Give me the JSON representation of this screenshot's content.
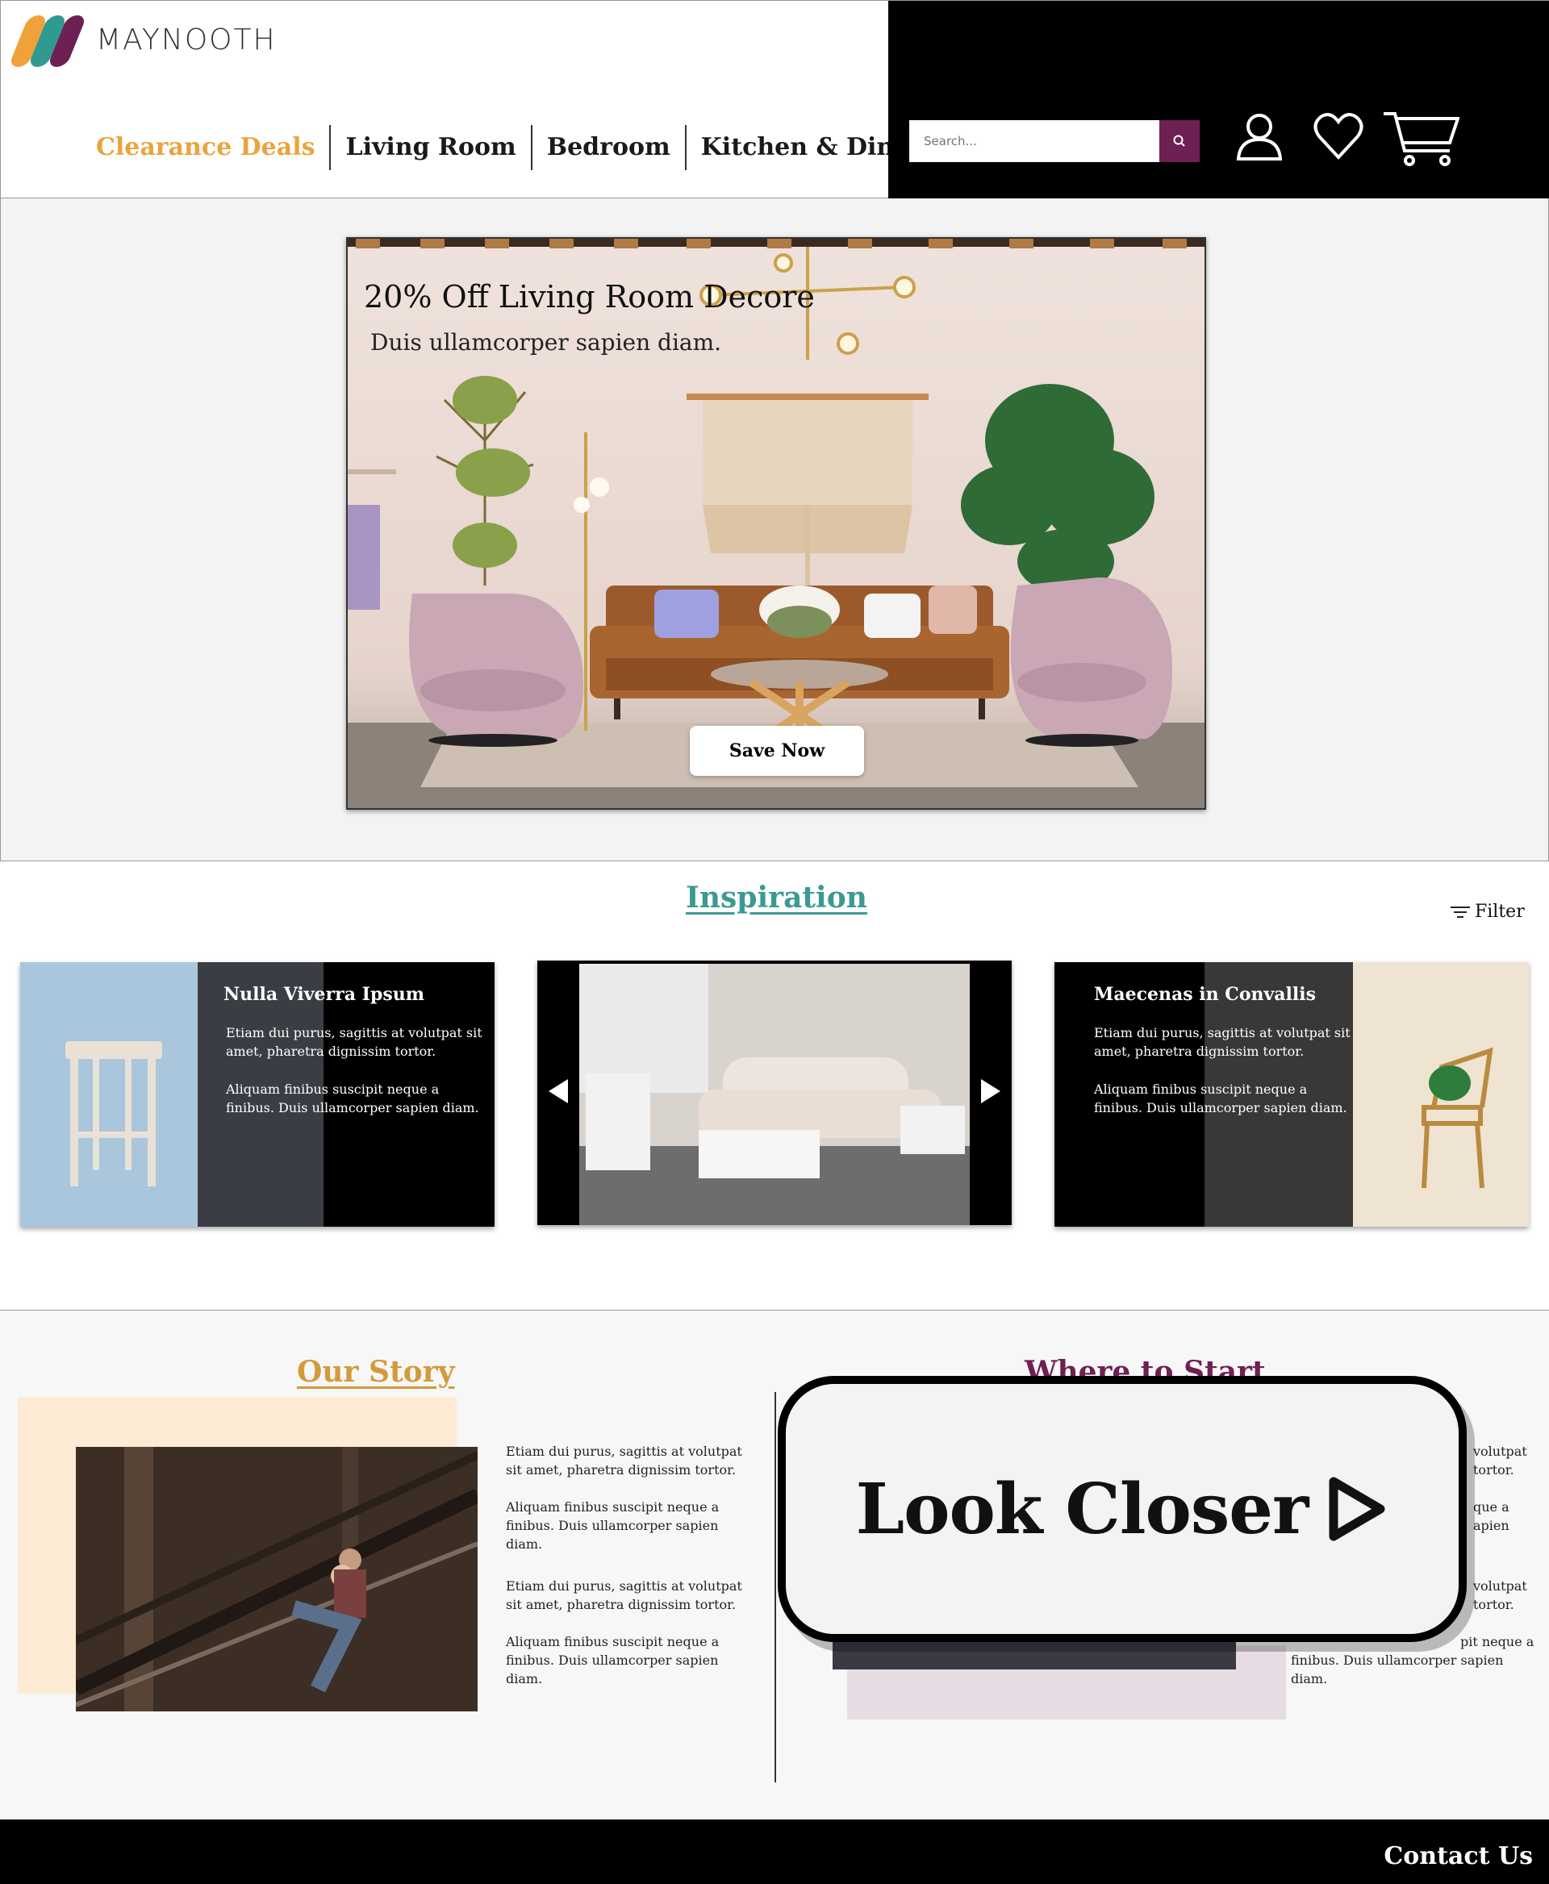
{
  "brand": {
    "name": "MAYNOOTH",
    "colors": {
      "orange": "#f0a23a",
      "teal": "#2f9a8f",
      "purple": "#6e2052"
    }
  },
  "nav": [
    {
      "label": "Clearance Deals",
      "color": "#e8a53f"
    },
    {
      "label": "Living Room",
      "color": "#1a1a1a"
    },
    {
      "label": "Bedroom",
      "color": "#1a1a1a"
    },
    {
      "label": "Kitchen & Dining",
      "color": "#1a1a1a"
    }
  ],
  "search": {
    "placeholder": "Search...",
    "button_color": "#6e2052",
    "icon": "search-icon"
  },
  "header_icons": [
    "user-icon",
    "heart-icon",
    "cart-icon"
  ],
  "hero": {
    "title": "20% Off Living Room Decore",
    "subtitle": "Duis ullamcorper sapien diam.",
    "cta": "Save Now"
  },
  "inspiration": {
    "title": "Inspiration",
    "filter_label": "Filter",
    "cards": [
      {
        "title": "Nulla Viverra Ipsum",
        "p1": "Etiam dui purus, sagittis at volutpat sit amet, pharetra dignissim tortor.",
        "p2": "Aliquam finibus suscipit neque a finibus. Duis ullamcorper sapien diam."
      },
      {
        "prev_icon": "chevron-left-icon",
        "next_icon": "chevron-right-icon"
      },
      {
        "title": "Maecenas in Convallis",
        "p1": "Etiam dui purus, sagittis at volutpat sit amet, pharetra dignissim tortor.",
        "p2": "Aliquam finibus suscipit neque a finibus. Duis ullamcorper sapien diam."
      }
    ]
  },
  "story": {
    "title": "Our Story",
    "title_color": "#d49a3a",
    "paragraphs": [
      "Etiam dui purus, sagittis at volutpat sit amet, pharetra dignissim tortor.",
      "Aliquam finibus suscipit neque a finibus. Duis ullamcorper sapien diam.",
      "Etiam dui purus, sagittis at volutpat sit amet, pharetra dignissim tortor.",
      "Aliquam finibus suscipit neque a finibus. Duis ullamcorper sapien diam."
    ]
  },
  "start": {
    "title": "Where to Start",
    "title_color": "#6e2052",
    "fragments": [
      "volutpat",
      "tortor.",
      "que a",
      "apien",
      "volutpat",
      "tortor.",
      "pit neque a",
      "finibus. Duis ullamcorper sapien",
      "diam."
    ]
  },
  "overlay": {
    "label": "Look Closer",
    "icon": "play-icon"
  },
  "footer": {
    "contact": "Contact Us"
  }
}
